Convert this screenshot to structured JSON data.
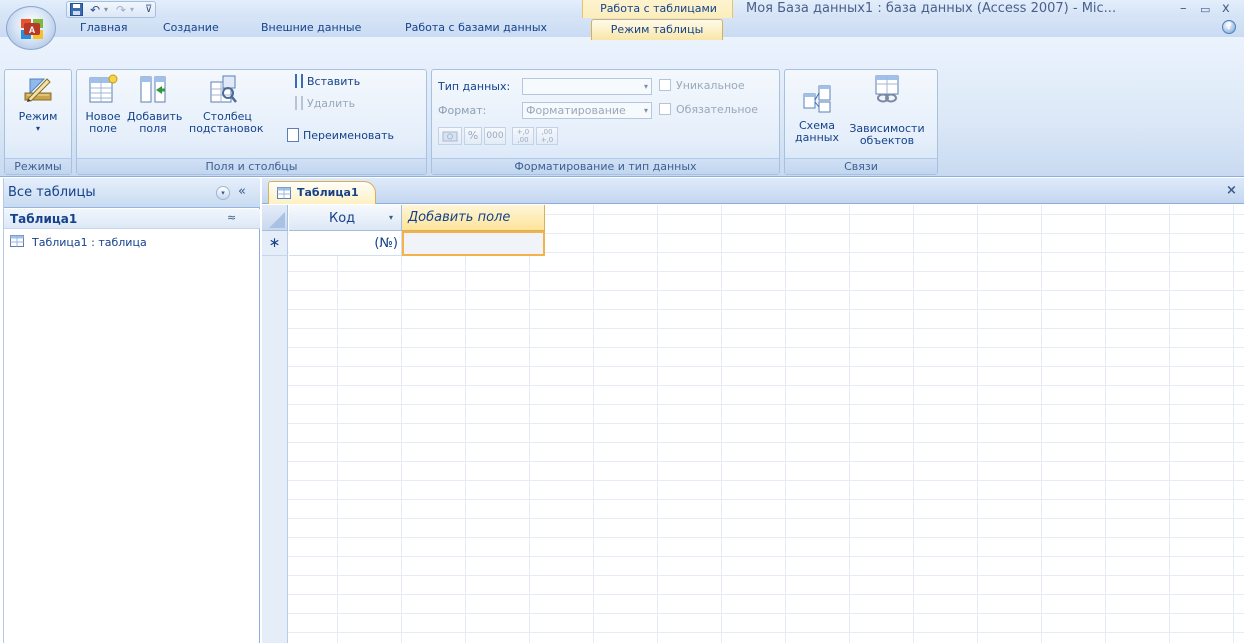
{
  "window": {
    "title": "Моя База данных1 : база данных (Access 2007) - Mic...",
    "minimize": "–",
    "restore": "▭",
    "close": "x",
    "context_tab_group": "Работа с таблицами"
  },
  "quick_access": {
    "save_icon": "save-icon",
    "undo_icon": "undo-icon",
    "redo_icon": "redo-icon",
    "customize_icon": "customize-arrow-icon"
  },
  "tabs": [
    "Главная",
    "Создание",
    "Внешние данные",
    "Работа с базами данных",
    "Режим таблицы"
  ],
  "active_tab": "Режим таблицы",
  "help_icon": "?",
  "ribbon": {
    "modes": {
      "label": "Режимы",
      "mode_button": "Режим"
    },
    "fields": {
      "label": "Поля и столбцы",
      "new_field_line1": "Новое",
      "new_field_line2": "поле",
      "add_fields_line1": "Добавить",
      "add_fields_line2": "поля",
      "lookup_line1": "Столбец",
      "lookup_line2": "подстановок",
      "insert": "Вставить",
      "delete": "Удалить",
      "rename": "Переименовать"
    },
    "formatting": {
      "label": "Форматирование и тип данных",
      "data_type_label": "Тип данных:",
      "data_type_value": "",
      "format_label": "Формат:",
      "format_value": "Форматирование",
      "unique": "Уникальное",
      "required": "Обязательное",
      "percent": "%",
      "thousands": "000",
      "increase_decimals": "+,0 ,00",
      "decrease_decimals": ",00 +,0"
    },
    "relations": {
      "label": "Связи",
      "schema_line1": "Схема",
      "schema_line2": "данных",
      "deps_line1": "Зависимости",
      "deps_line2": "объектов"
    }
  },
  "nav_pane": {
    "title": "Все таблицы",
    "dropdown": "▾",
    "collapse": "«",
    "group_title": "Таблица1",
    "group_chevron": "≈",
    "items": [
      {
        "label": "Таблица1 : таблица",
        "icon": "table-icon"
      }
    ]
  },
  "document": {
    "tab_label": "Таблица1",
    "close": "×",
    "columns": [
      {
        "header": "Код",
        "new_row_value": "(№)"
      },
      {
        "header": "Добавить поле",
        "new_row_value": ""
      }
    ],
    "new_row_marker": "∗",
    "column_dropdown": "▾"
  }
}
